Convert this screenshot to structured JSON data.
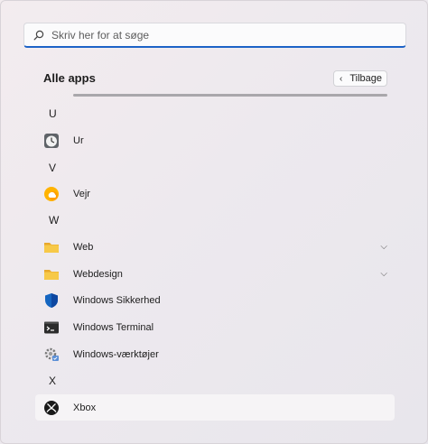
{
  "search": {
    "placeholder": "Skriv her for at søge"
  },
  "header": {
    "title": "Alle apps",
    "back_label": "Tilbage"
  },
  "sections": [
    {
      "letter": "U"
    },
    {
      "letter": "V"
    },
    {
      "letter": "W"
    },
    {
      "letter": "X"
    }
  ],
  "apps": [
    {
      "label": "Ur",
      "icon": "clock-icon"
    },
    {
      "label": "Vejr",
      "icon": "weather-icon"
    },
    {
      "label": "Web",
      "icon": "folder-icon"
    },
    {
      "label": "Webdesign",
      "icon": "folder-icon"
    },
    {
      "label": "Windows Sikkerhed",
      "icon": "shield-icon"
    },
    {
      "label": "Windows Terminal",
      "icon": "terminal-icon"
    },
    {
      "label": "Windows-værktøjer",
      "icon": "tools-icon"
    },
    {
      "label": "Xbox",
      "icon": "xbox-icon"
    }
  ],
  "colors": {
    "accent": "#1d63c7",
    "folder": "#f7c948",
    "shield": "#1565c0"
  }
}
